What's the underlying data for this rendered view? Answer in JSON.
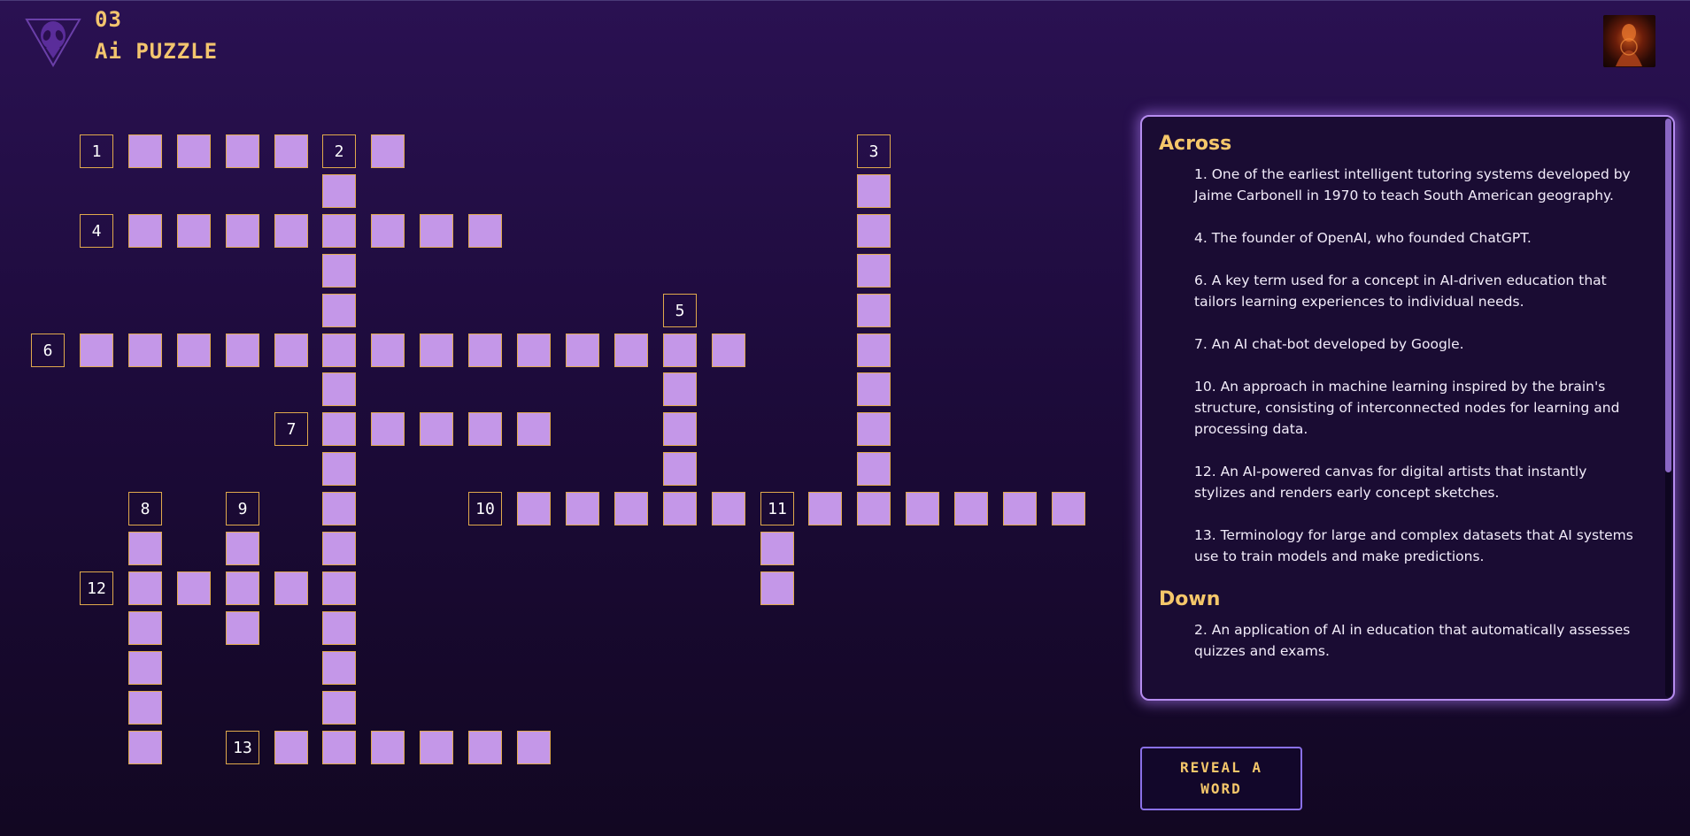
{
  "header": {
    "level": "03",
    "title": "Ai PUZZLE"
  },
  "colors": {
    "cell_fill": "#c497e8",
    "cell_border": "#e0a94c",
    "accent_gold": "#f5c76a",
    "panel_border": "#b68df0"
  },
  "icons": {
    "logo": "alien-triangle-logo",
    "avatar": "user-avatar"
  },
  "grid": {
    "numbered_cells": [
      {
        "label": "1",
        "row": 0,
        "col": 1
      },
      {
        "label": "2",
        "row": 0,
        "col": 6
      },
      {
        "label": "3",
        "row": 0,
        "col": 17
      },
      {
        "label": "4",
        "row": 2,
        "col": 1
      },
      {
        "label": "5",
        "row": 4,
        "col": 13
      },
      {
        "label": "6",
        "row": 5,
        "col": 0
      },
      {
        "label": "7",
        "row": 7,
        "col": 5
      },
      {
        "label": "8",
        "row": 9,
        "col": 2
      },
      {
        "label": "9",
        "row": 9,
        "col": 4
      },
      {
        "label": "10",
        "row": 9,
        "col": 9
      },
      {
        "label": "11",
        "row": 9,
        "col": 15
      },
      {
        "label": "12",
        "row": 11,
        "col": 1
      },
      {
        "label": "13",
        "row": 15,
        "col": 4
      }
    ],
    "cells": [
      [
        0,
        2
      ],
      [
        0,
        3
      ],
      [
        0,
        4
      ],
      [
        0,
        5
      ],
      [
        0,
        7
      ],
      [
        1,
        6
      ],
      [
        1,
        17
      ],
      [
        2,
        2
      ],
      [
        2,
        3
      ],
      [
        2,
        4
      ],
      [
        2,
        5
      ],
      [
        2,
        6
      ],
      [
        2,
        7
      ],
      [
        2,
        8
      ],
      [
        2,
        9
      ],
      [
        2,
        17
      ],
      [
        3,
        6
      ],
      [
        3,
        17
      ],
      [
        4,
        6
      ],
      [
        4,
        17
      ],
      [
        5,
        1
      ],
      [
        5,
        2
      ],
      [
        5,
        3
      ],
      [
        5,
        4
      ],
      [
        5,
        5
      ],
      [
        5,
        6
      ],
      [
        5,
        7
      ],
      [
        5,
        8
      ],
      [
        5,
        9
      ],
      [
        5,
        10
      ],
      [
        5,
        11
      ],
      [
        5,
        12
      ],
      [
        5,
        13
      ],
      [
        5,
        14
      ],
      [
        5,
        17
      ],
      [
        6,
        6
      ],
      [
        6,
        13
      ],
      [
        6,
        17
      ],
      [
        7,
        6
      ],
      [
        7,
        7
      ],
      [
        7,
        8
      ],
      [
        7,
        9
      ],
      [
        7,
        10
      ],
      [
        7,
        13
      ],
      [
        7,
        17
      ],
      [
        8,
        6
      ],
      [
        8,
        13
      ],
      [
        8,
        17
      ],
      [
        9,
        6
      ],
      [
        9,
        10
      ],
      [
        9,
        11
      ],
      [
        9,
        12
      ],
      [
        9,
        13
      ],
      [
        9,
        14
      ],
      [
        9,
        16
      ],
      [
        9,
        17
      ],
      [
        9,
        18
      ],
      [
        9,
        19
      ],
      [
        9,
        20
      ],
      [
        9,
        21
      ],
      [
        10,
        2
      ],
      [
        10,
        4
      ],
      [
        10,
        6
      ],
      [
        10,
        15
      ],
      [
        11,
        2
      ],
      [
        11,
        3
      ],
      [
        11,
        4
      ],
      [
        11,
        5
      ],
      [
        11,
        6
      ],
      [
        11,
        15
      ],
      [
        12,
        2
      ],
      [
        12,
        4
      ],
      [
        12,
        6
      ],
      [
        13,
        2
      ],
      [
        13,
        6
      ],
      [
        14,
        2
      ],
      [
        14,
        6
      ],
      [
        15,
        2
      ],
      [
        15,
        5
      ],
      [
        15,
        6
      ],
      [
        15,
        7
      ],
      [
        15,
        8
      ],
      [
        15,
        9
      ],
      [
        15,
        10
      ]
    ]
  },
  "clues": {
    "across_title": "Across",
    "across": [
      "1. One of the earliest intelligent tutoring systems developed by Jaime Carbonell in 1970 to teach South American geography.",
      "4. The founder of OpenAI, who founded ChatGPT.",
      "6. A key term used for a concept in AI-driven education that tailors learning experiences to individual needs.",
      "7. An AI chat-bot developed by Google.",
      "10. An approach in machine learning inspired by the brain's structure, consisting of interconnected nodes for learning and processing data.",
      "12. An AI-powered canvas for digital artists that instantly stylizes and renders early concept sketches.",
      "13. Terminology for large and complex datasets that AI systems use to train models and make predictions."
    ],
    "down_title": "Down",
    "down": [
      "2. An application of AI in education that automatically assesses quizzes and exams."
    ]
  },
  "actions": {
    "reveal_label": "REVEAL A WORD"
  }
}
